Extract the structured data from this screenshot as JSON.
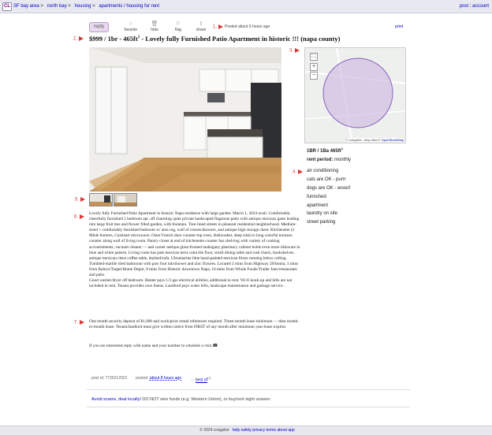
{
  "header": {
    "logo": "CL",
    "breadcrumbs": [
      "SF bay area",
      ">",
      "north bay",
      ">",
      "housing",
      ">",
      "apartments / housing for rent"
    ],
    "post_label": "post",
    "account_label": "account"
  },
  "actions": {
    "reply": "reply",
    "favorite": "favorite",
    "hide": "hide",
    "flag": "flag",
    "share": "share",
    "posted": "Posted about 6 hours ago",
    "print": "print"
  },
  "annotations": {
    "a1": "1.",
    "a2": "2.",
    "a3": "3.",
    "a4": "4.",
    "a5": "5.",
    "a6": "6.",
    "a7": "7."
  },
  "listing": {
    "title_part1": "$999 / 1br - 465ft",
    "title_sup": "2",
    "title_part2": " - Lovely fully Furnished Patio Apartment in historic !!! (napa county)"
  },
  "map": {
    "zoom_in": "+",
    "zoom_out": "−",
    "fullscreen": "⛶",
    "attribution_prefix": "© craigslist - Map data © ",
    "attribution_link": "OpenStreetMap"
  },
  "attributes": {
    "bed_bath": "1BR / 1Ba 465ft",
    "bed_bath_sup": "2",
    "rent_period_label": "rent period:",
    "rent_period_value": "monthly",
    "items": [
      "air conditioning",
      "cats are OK - purrr",
      "dogs are OK - wooof",
      "furnished",
      "apartment",
      "laundry on site",
      "street parking"
    ]
  },
  "description": {
    "p1": "Lovely fully Furnished Patio Apartment in historic Napa residence with large garden. March 1, 2024 avail. Comfortable, cheerfully furnished 1 bedroom apt. off charming quiet private landscaped flagstone patio with antique mexican gates leading into large fruit tree and flower filled garden, with fountain. Tree-lined streets in pleasant residential neighborhood. Medium-sized + comfortably furnished bedroom w/ area rug, wall of closets/drawers, and antique high storage chest. Kitchenette (2 Miele burners, Cuisinart microwave, Oster French door counter-top oven, dishwasher, deep sink) is long colorful terrazzo counter along wall of living room. Pantry closet at end of kitchenette counter has shelving with variety of cooking accoutrements, vacuum cleaner — and corner antique glass-fronted mahogany pharmacy cabinet holds even more dishware in blue and white pattern. Living room has pale mexican terra cotta tile floor, small dining table and rush chairs, bookshelves, antique mexican chest coffee table, daybed/sofa. Ultramarine blue hand-painted mexican frieze running below ceiling. Tumbled-marble tiled bathroom with paw foot tub/shower and zinc fixtures. Located 2 mins from Highway 29/Imola; 3 mins from Raleys/Target/Home Depot, 8 mins from Historic downtown Napa, 10 mins from Whole Foods/Trader Joes/restaurants and pubs.",
    "p2": "Good washer/dryer off bedroom. Renter pays 1/3 gas electrical utilities, additional to rent. Wi-fi hook-up and bills are not included in rent. Tenant provides own linens. Landlord pays water bills, landscape maintenance and garbage service.",
    "p3": "One month security deposit of $1,000 and work/prior rental references required. Three-month lease minimum — then month-to-month lease. Tenant/landlord must give written notice from FIRST of any month after minimum year-lease expires.",
    "p4": "If you are interested reply with name and your number to schedule a visit.☎"
  },
  "meta": {
    "post_id": "post id: 7726212922",
    "posted_label": "posted:",
    "posted_value": "about 8 hours ago",
    "best_of": "best of",
    "best_of_sup": "[?]"
  },
  "scam": {
    "link": "Avoid scams, deal locally!",
    "text": " DO NOT wire funds (e.g. Western Union), or buy/rent sight unseen"
  },
  "footer": {
    "copyright": "© 2024 craigslist",
    "links": [
      "help",
      "safety",
      "privacy",
      "terms",
      "about",
      "app"
    ]
  }
}
